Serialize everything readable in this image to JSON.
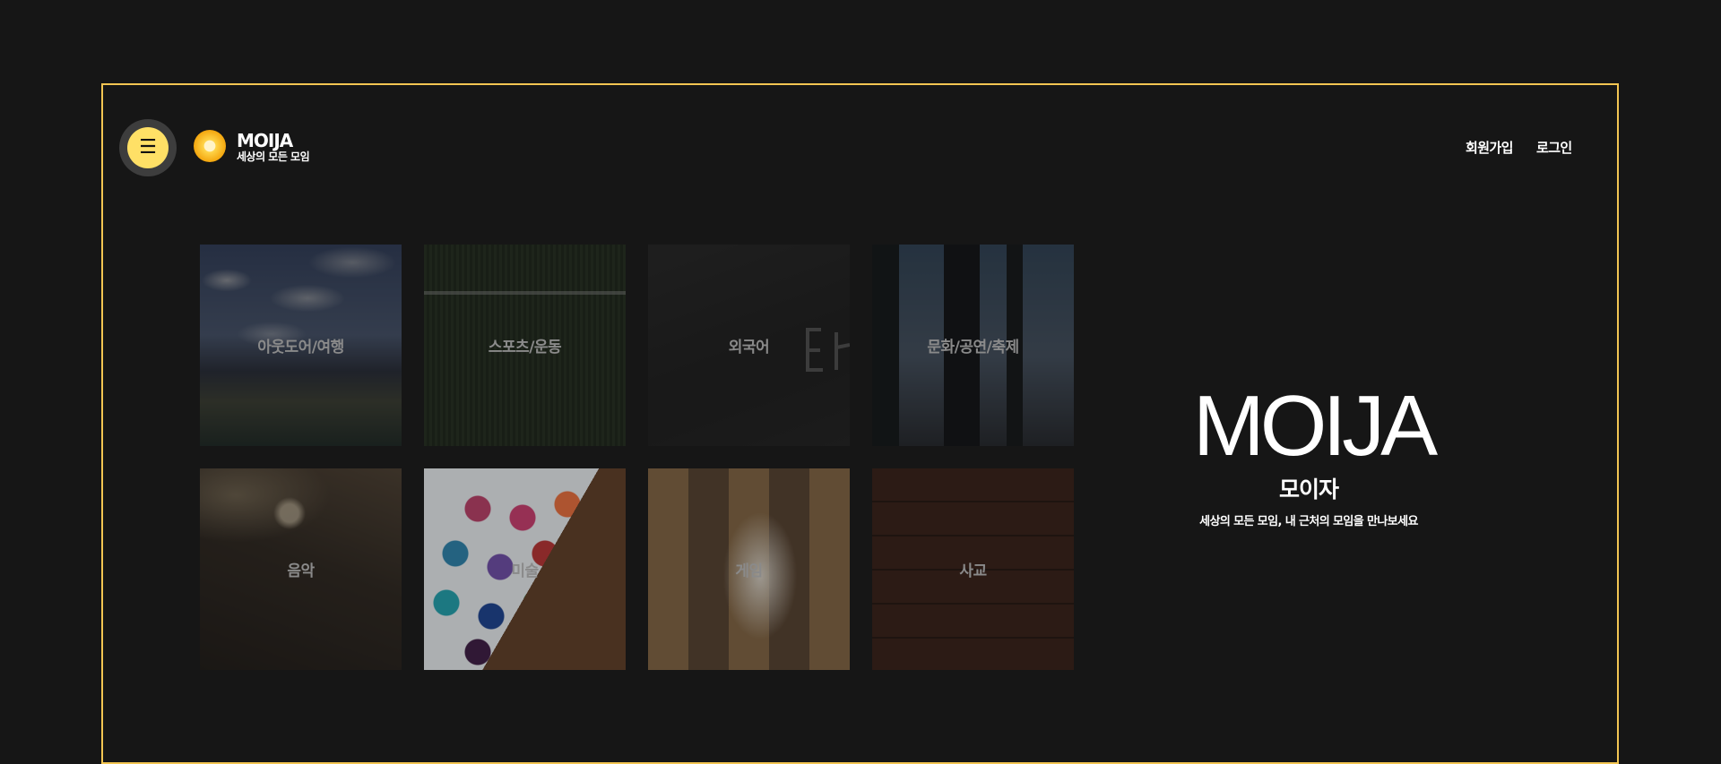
{
  "header": {
    "menu_icon": "☰",
    "brand_title": "MOIJA",
    "brand_subtitle": "세상의 모든 모임",
    "signup_label": "회원가입",
    "login_label": "로그인"
  },
  "categories": [
    {
      "label": "아웃도어/여행"
    },
    {
      "label": "스포츠/운동"
    },
    {
      "label": "외국어"
    },
    {
      "label": "문화/공연/축제"
    },
    {
      "label": "음악"
    },
    {
      "label": "미술"
    },
    {
      "label": "게임"
    },
    {
      "label": "사교"
    }
  ],
  "hero": {
    "title": "MOIJA",
    "subtitle": "모이자",
    "description": "세상의 모든 모임, 내 근처의 모임을 만나보세요"
  },
  "colors": {
    "background": "#161616",
    "frame_border": "#f2c552",
    "menu_button": "#ffe066",
    "tile_label": "#8a8a8a"
  },
  "icons": {
    "menu": "hamburger-icon",
    "logo": "sun-logo-icon"
  }
}
